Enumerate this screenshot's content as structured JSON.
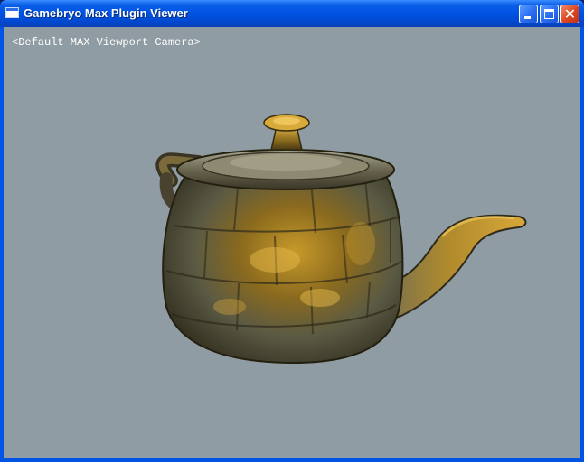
{
  "window": {
    "title": "Gamebryo Max Plugin Viewer",
    "icon": "app-window-icon",
    "controls": {
      "minimize_icon": "minimize-icon",
      "maximize_icon": "maximize-icon",
      "close_glyph": "✕"
    }
  },
  "viewport": {
    "camera_label": "<Default MAX Viewport Camera>",
    "background_color": "#909ca3",
    "model": "teapot"
  },
  "colors": {
    "titlebar": "#0054e3",
    "close_button": "#d9451f"
  }
}
